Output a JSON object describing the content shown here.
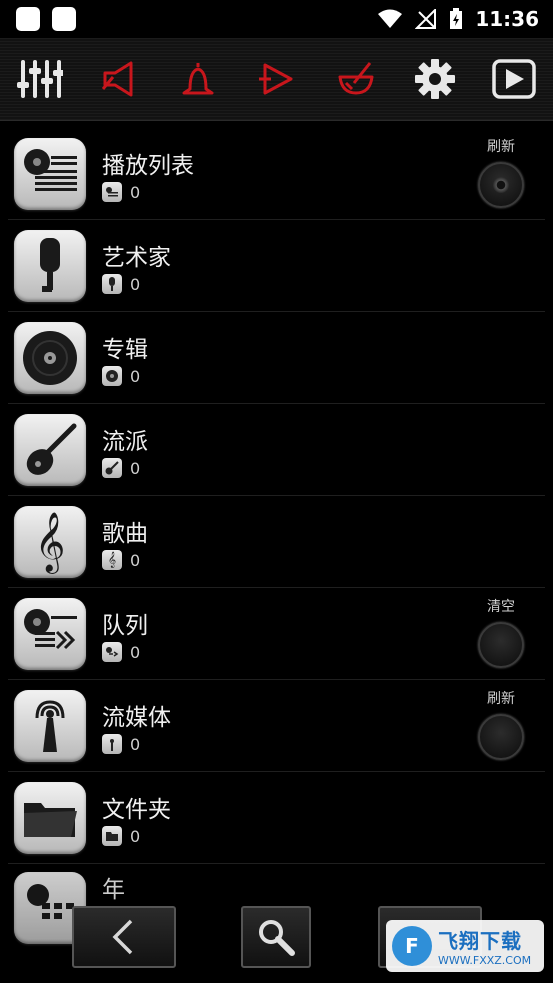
{
  "status_bar": {
    "time": "11:36"
  },
  "toolbar": {
    "buttons": [
      {
        "icon": "equalizer-icon"
      },
      {
        "icon": "speaker-icon"
      },
      {
        "icon": "bell-icon"
      },
      {
        "icon": "play-arrow-icon"
      },
      {
        "icon": "mortar-icon"
      },
      {
        "icon": "gear-icon"
      },
      {
        "icon": "play-box-icon"
      }
    ]
  },
  "list": {
    "items": [
      {
        "title": "播放列表",
        "count": "0",
        "action_label": "刷新",
        "icon": "playlist-icon"
      },
      {
        "title": "艺术家",
        "count": "0",
        "icon": "microphone-icon"
      },
      {
        "title": "专辑",
        "count": "0",
        "icon": "disc-icon"
      },
      {
        "title": "流派",
        "count": "0",
        "icon": "guitar-icon"
      },
      {
        "title": "歌曲",
        "count": "0",
        "icon": "treble-clef-icon"
      },
      {
        "title": "队列",
        "count": "0",
        "action_label": "清空",
        "icon": "queue-icon"
      },
      {
        "title": "流媒体",
        "count": "0",
        "action_label": "刷新",
        "icon": "antenna-icon"
      },
      {
        "title": "文件夹",
        "count": "0",
        "icon": "folder-icon"
      },
      {
        "title": "年",
        "icon": "calendar-icon"
      }
    ]
  },
  "bottom_nav": {
    "back_icon": "chevron-left-icon",
    "search_icon": "search-icon"
  },
  "watermark": {
    "badge": "F",
    "title": "飞翔下载",
    "subtitle": "WWW.FXXZ.COM"
  },
  "colors": {
    "toolbar_red": "#c8161c",
    "toolbar_white": "#e8e8e8",
    "background": "#000000"
  }
}
